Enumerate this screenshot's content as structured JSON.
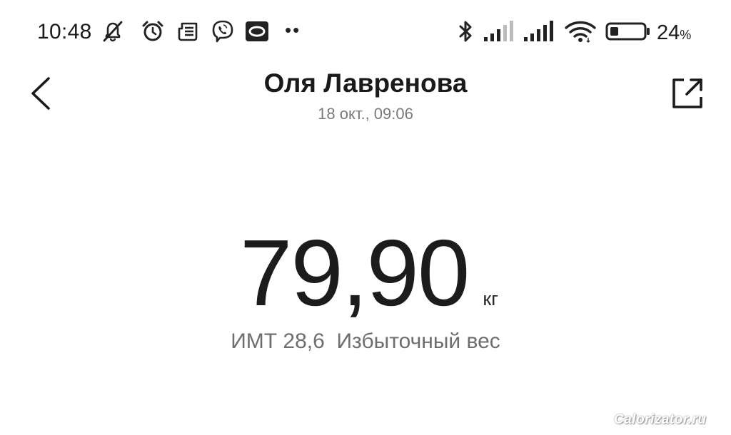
{
  "status_bar": {
    "time": "10:48",
    "battery_percent": "24",
    "battery_percent_sign": "%",
    "battery_level": 0.24,
    "more_indicator": "••",
    "icons": [
      "muted-bell-icon",
      "alarm-clock-icon",
      "news-icon",
      "viber-icon",
      "app-o-icon",
      "bluetooth-icon",
      "signal-1-icon",
      "signal-2-icon",
      "wifi-icon",
      "battery-icon"
    ]
  },
  "header": {
    "title": "Оля Лавренова",
    "subtitle": "18 окт., 09:06",
    "back_icon": "chevron-left-icon",
    "share_icon": "share-external-icon"
  },
  "measurement": {
    "weight": "79,90",
    "unit": "кг",
    "bmi_label": "ИМТ 28,6",
    "bmi_status": "Избыточный вес"
  },
  "watermark": {
    "text": "Calorizator.ru"
  }
}
